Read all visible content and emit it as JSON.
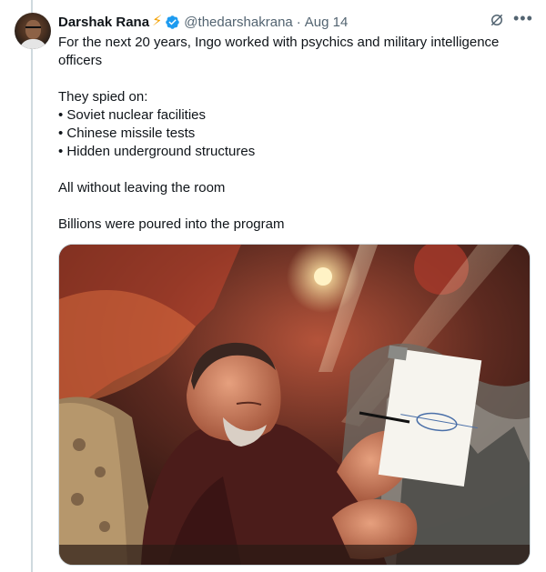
{
  "tweet": {
    "author_name": "Darshak Rana",
    "author_emoji": "⚡",
    "handle": "@thedarshakrana",
    "separator": "·",
    "date": "Aug 14",
    "lines": [
      "For the next 20 years, Ingo worked with psychics and military intelligence officers",
      "They spied on:",
      "• Soviet nuclear facilities",
      "• Chinese missile tests",
      "• Hidden underground structures",
      "All without leaving the room",
      "Billions were poured into the program"
    ]
  },
  "icons": {
    "verified": "verified-badge-icon",
    "grok": "grok-icon",
    "more": "more-icon"
  },
  "colors": {
    "verified_blue": "#1d9bf0",
    "muted": "#536471",
    "text": "#0f1419",
    "border": "#cfd9de"
  }
}
